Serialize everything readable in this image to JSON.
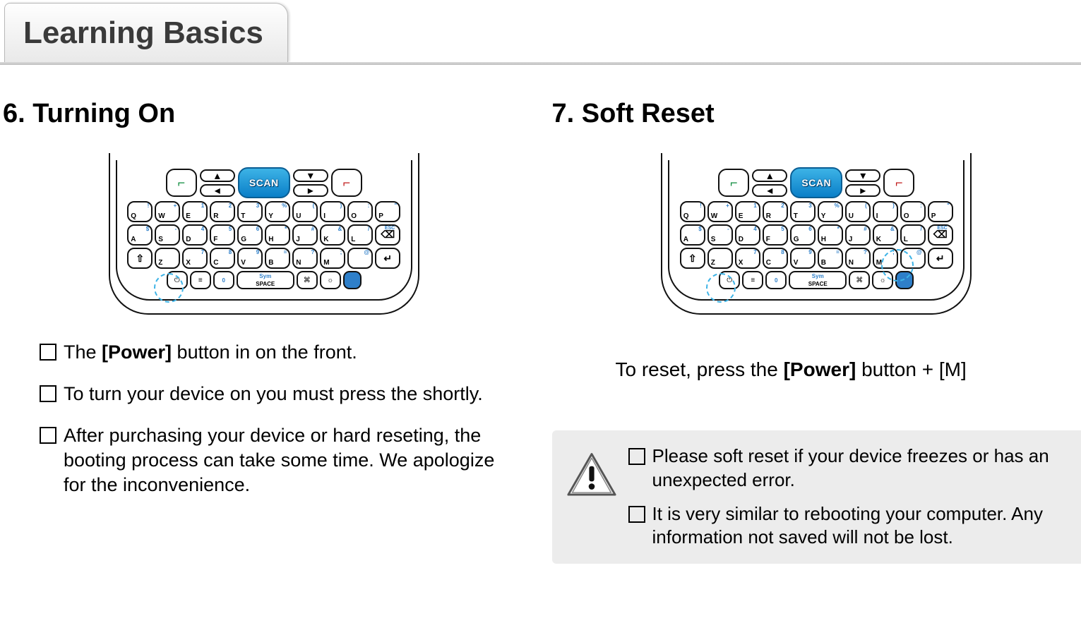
{
  "header": {
    "tab_label": "Learning Basics"
  },
  "left": {
    "title": "6. Turning On",
    "bullets": [
      {
        "pre": "The ",
        "bold": "[Power]",
        "post": " button in on the front."
      },
      {
        "pre": "To turn your device on you must press the shortly.",
        "bold": "",
        "post": ""
      },
      {
        "pre": "After purchasing your device or hard reseting, the booting process can take some time. We apologize for the inconvenience.",
        "bold": "",
        "post": ""
      }
    ]
  },
  "right": {
    "title": "7. Soft Reset",
    "reset_line_pre": "To reset, press the ",
    "reset_line_bold": "[Power]",
    "reset_line_post": " button + [M]",
    "caution": [
      {
        "pre": "Please soft reset if your device freezes or has an unexpected error.",
        "bold": "",
        "post": ""
      },
      {
        "pre": "It is very similar to rebooting your computer. Any information not saved will not be lost.",
        "bold": "",
        "post": ""
      }
    ]
  },
  "device": {
    "scan_label": "SCAN",
    "row1": [
      {
        "k": "Q",
        "s": "!"
      },
      {
        "k": "W",
        "s": "+"
      },
      {
        "k": "E",
        "s": "1"
      },
      {
        "k": "R",
        "s": "2"
      },
      {
        "k": "T",
        "s": "3"
      },
      {
        "k": "Y",
        "s": "%"
      },
      {
        "k": "U",
        "s": "("
      },
      {
        "k": "I",
        "s": ")"
      },
      {
        "k": "O",
        "s": ":"
      },
      {
        "k": "P",
        "s": "\""
      }
    ],
    "row2": [
      {
        "k": "A",
        "s": "$"
      },
      {
        "k": "S",
        "s": "-"
      },
      {
        "k": "D",
        "s": "4"
      },
      {
        "k": "F",
        "s": "5"
      },
      {
        "k": "G",
        "s": "6"
      },
      {
        "k": "H",
        "s": "*"
      },
      {
        "k": "J",
        "s": "#"
      },
      {
        "k": "K",
        "s": "&"
      },
      {
        "k": "L",
        "s": "/"
      },
      {
        "k": "",
        "s": "ESC",
        "esc": true
      }
    ],
    "row3": [
      {
        "k": "⇧",
        "shift": true
      },
      {
        "k": "Z",
        "s": ""
      },
      {
        "k": "X",
        "s": "7"
      },
      {
        "k": "C",
        "s": "8"
      },
      {
        "k": "V",
        "s": "9"
      },
      {
        "k": "B",
        "s": "="
      },
      {
        "k": "N",
        "s": "?"
      },
      {
        "k": "M",
        "s": ";"
      },
      {
        "k": "",
        "s": "@"
      },
      {
        "k": "↵",
        "shift": true
      }
    ],
    "space_label": "SPACE",
    "sym_label": "Sym",
    "zero_label": "0"
  }
}
